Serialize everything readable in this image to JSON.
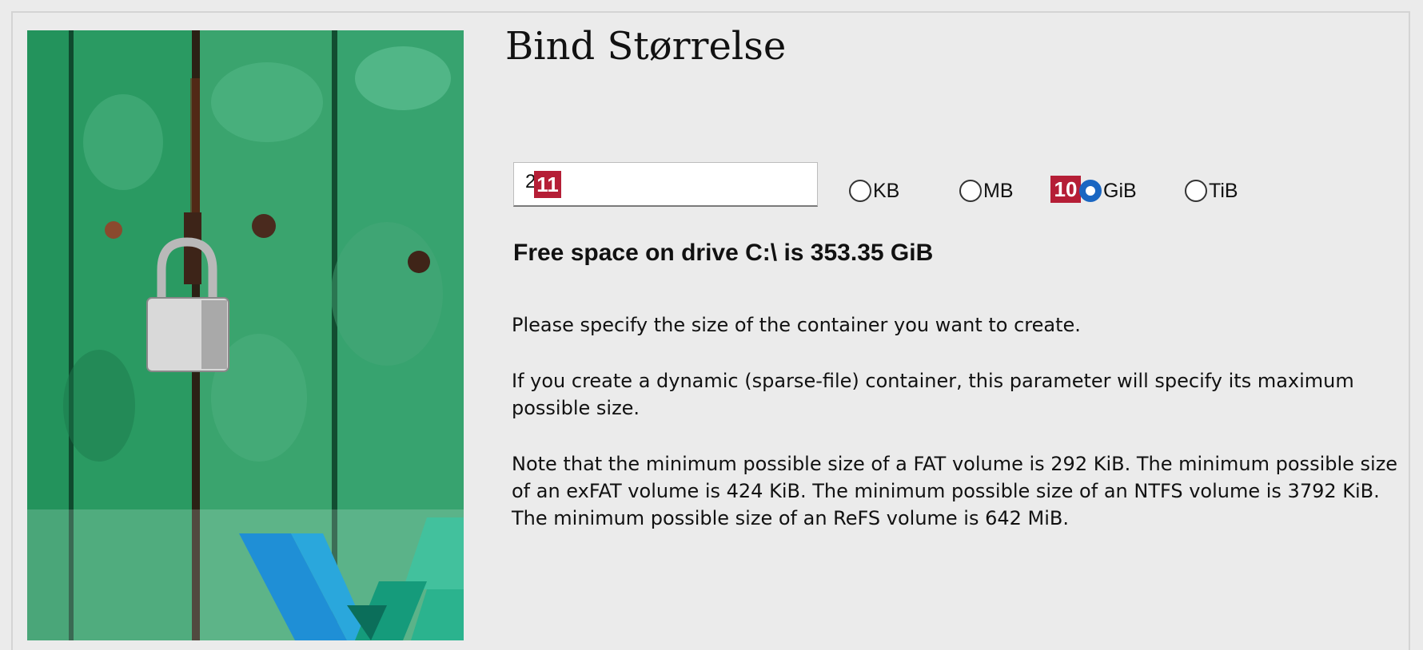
{
  "title": "Bind Størrelse",
  "size_input": {
    "value": "2",
    "badge": "11"
  },
  "units": {
    "selected": "GiB",
    "options": [
      {
        "label": "KB",
        "checked": false
      },
      {
        "label": "MB",
        "checked": false
      },
      {
        "label": "GiB",
        "checked": true,
        "badge": "10"
      },
      {
        "label": "TiB",
        "checked": false
      }
    ]
  },
  "free_space": "Free space on drive C:\\ is 353.35 GiB",
  "paragraphs": [
    "Please specify the size of the container you want to create.",
    "If you create a dynamic (sparse-file) container, this parameter will specify its maximum possible size.",
    "Note that the minimum possible size of a FAT volume is 292 KiB. The minimum possible size of an exFAT volume is 424 KiB. The minimum possible size of an NTFS volume is 3792 KiB. The minimum possible size of an ReFS volume is 642 MiB."
  ],
  "colors": {
    "accent": "#1a66c2",
    "badge": "#b51e36",
    "background": "#ebebeb"
  },
  "side_image": {
    "icon": "padlock-on-green-door-image"
  }
}
